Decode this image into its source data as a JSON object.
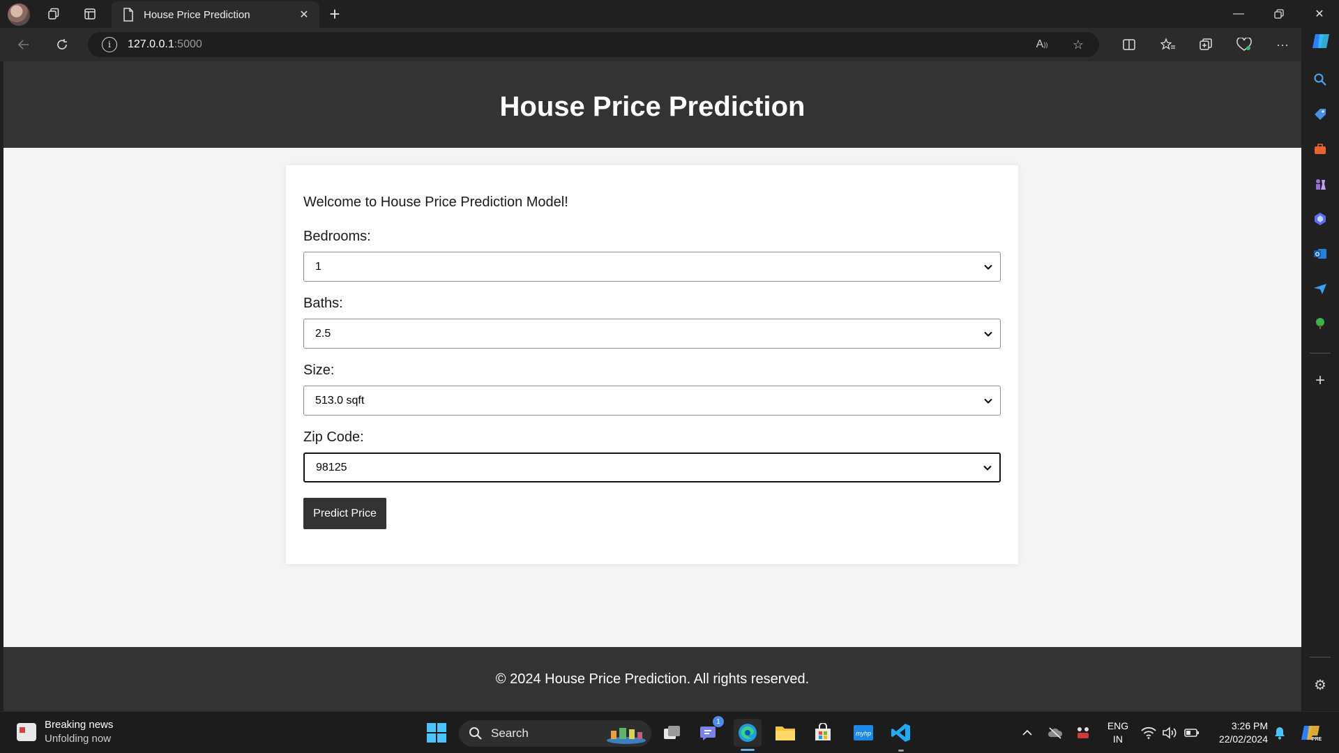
{
  "browser": {
    "tab_title": "House Price Prediction",
    "url_host": "127.0.0.1",
    "url_port": ":5000",
    "accent_color": "#1e90ff"
  },
  "page": {
    "header_title": "House Price Prediction",
    "welcome_text": "Welcome to House Price Prediction Model!",
    "fields": [
      {
        "label": "Bedrooms:",
        "value": "1"
      },
      {
        "label": "Baths:",
        "value": "2.5"
      },
      {
        "label": "Size:",
        "value": "513.0 sqft"
      },
      {
        "label": "Zip Code:",
        "value": "98125"
      }
    ],
    "predict_button": "Predict Price",
    "footer_text": "© 2024 House Price Prediction. All rights reserved.",
    "colors": {
      "header_bg": "#333333",
      "page_bg": "#f4f4f4",
      "card_bg": "#ffffff"
    }
  },
  "taskbar": {
    "news_title": "Breaking news",
    "news_subtitle": "Unfolding now",
    "search_placeholder": "Search",
    "chat_badge": "1",
    "language_line1": "ENG",
    "language_line2": "IN",
    "time": "3:26 PM",
    "date": "22/02/2024"
  }
}
